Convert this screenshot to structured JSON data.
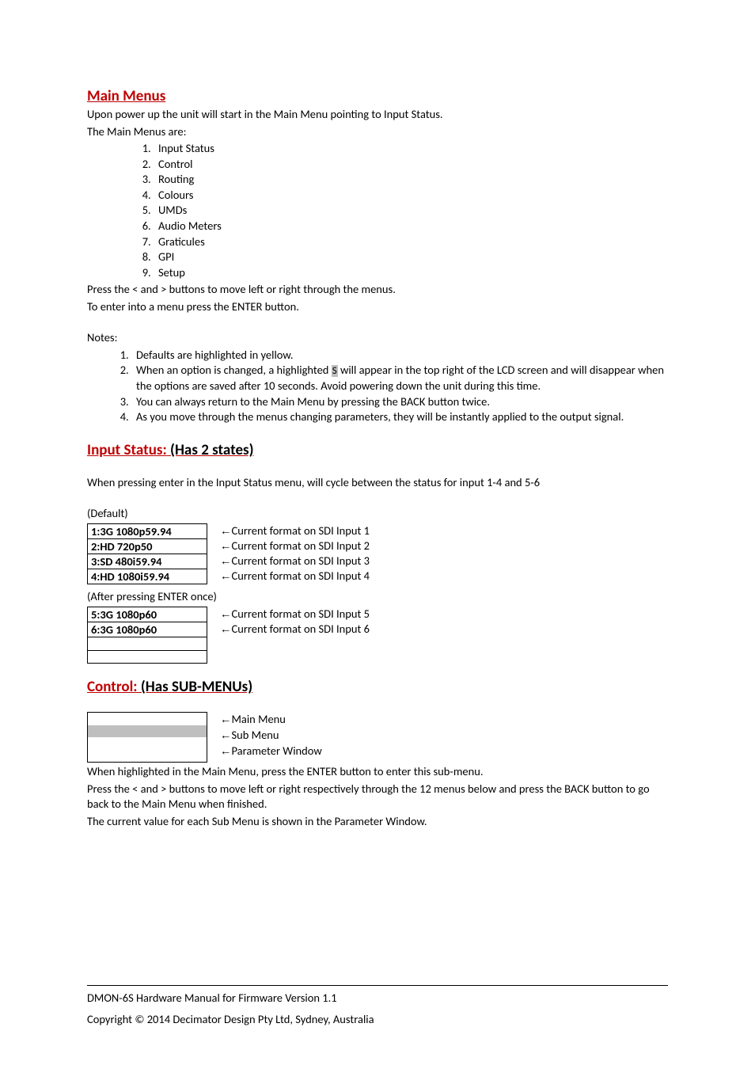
{
  "main_menus": {
    "title": "Main Menus",
    "intro1": "Upon power up the unit will start in the Main Menu pointing to Input Status.",
    "intro2": "The Main Menus are:",
    "items": [
      "Input Status",
      "Control",
      "Routing",
      "Colours",
      "UMDs",
      "Audio Meters",
      "Graticules",
      "GPI",
      "Setup"
    ],
    "nav1": "Press the < and > buttons to move left or right through the menus.",
    "nav2": "To enter into a menu press the ENTER button.",
    "notes_label": "Notes:",
    "notes": [
      "Defaults are highlighted in yellow.",
      "When an option is changed, a highlighted ",
      "You can always return to the Main Menu by pressing the BACK button twice.",
      "As you move through the menus changing parameters, they will be instantly applied to the output signal."
    ],
    "note2_tail": " will appear in the top right of the LCD screen and will disappear when the options are saved after 10 seconds.  Avoid powering down the unit during this time.",
    "note2_s": "S"
  },
  "input_status": {
    "title": "Input Status:",
    "suffix": " (Has 2 states)",
    "desc": "When pressing enter in the Input Status menu, will cycle between the status for input 1-4 and 5-6",
    "default_label": "(Default)",
    "block1": [
      {
        "left": "1:3G 1080p59.94",
        "right": "Current format on SDI Input 1"
      },
      {
        "left": "2:HD 720p50",
        "right": "Current format on SDI Input 2"
      },
      {
        "left": "3:SD 480i59.94",
        "right": "Current format on SDI Input 3"
      },
      {
        "left": "4:HD 1080i59.94",
        "right": "Current format on SDI Input 4"
      }
    ],
    "after_label": "(After pressing ENTER once)",
    "block2": [
      {
        "left": "5:3G 1080p60",
        "right": "Current format on SDI Input 5"
      },
      {
        "left": "6:3G 1080p60",
        "right": "Current format on SDI Input 6"
      }
    ]
  },
  "control": {
    "title": "Control:",
    "suffix": " (Has SUB-MENUs)",
    "legend": [
      "Main Menu",
      "Sub Menu",
      "Parameter Window"
    ],
    "p1": "When highlighted in the Main Menu, press the ENTER button to enter this sub-menu.",
    "p2": "Press the < and > buttons to move left or right respectively through the 12 menus below and press the BACK button to go back to the Main Menu when finished.",
    "p3": "The current value for each Sub Menu is shown in the Parameter Window."
  },
  "footer": {
    "line1": "DMON-6S Hardware Manual for Firmware Version 1.1",
    "line2": "Copyright © 2014 Decimator Design Pty Ltd, Sydney, Australia"
  }
}
